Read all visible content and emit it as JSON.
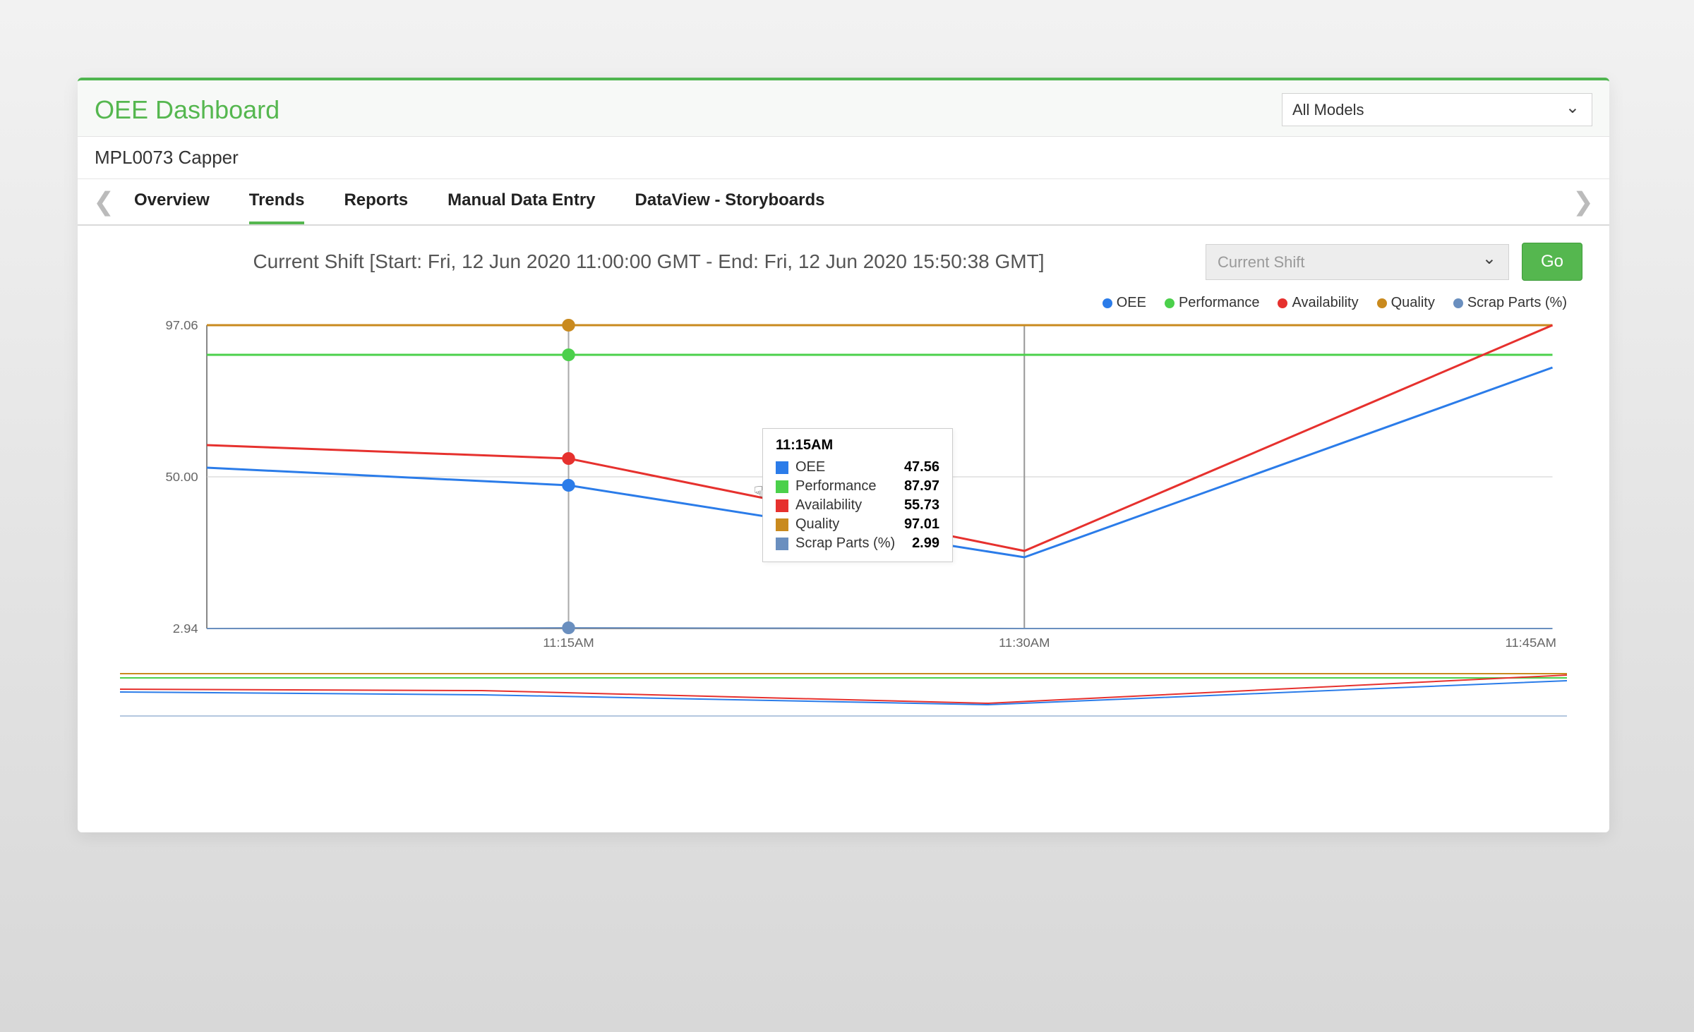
{
  "header": {
    "title": "OEE Dashboard",
    "model_placeholder": "All Models"
  },
  "equipment": "MPL0073 Capper",
  "tabs": {
    "overview": "Overview",
    "trends": "Trends",
    "reports": "Reports",
    "manual": "Manual Data Entry",
    "dataview": "DataView - Storyboards",
    "active": "trends"
  },
  "shift": {
    "label": "Current Shift [Start: Fri, 12 Jun 2020 11:00:00 GMT - End: Fri, 12 Jun 2020 15:50:38 GMT]",
    "select_placeholder": "Current Shift",
    "go_label": "Go"
  },
  "legend": {
    "oee": "OEE",
    "performance": "Performance",
    "availability": "Availability",
    "quality": "Quality",
    "scrap": "Scrap Parts (%)"
  },
  "tooltip": {
    "time": "11:15AM",
    "rows": {
      "oee_label": "OEE",
      "oee_val": "47.56",
      "perf_label": "Performance",
      "perf_val": "87.97",
      "avail_label": "Availability",
      "avail_val": "55.73",
      "qual_label": "Quality",
      "qual_val": "97.01",
      "scrap_label": "Scrap Parts (%)",
      "scrap_val": "2.99"
    }
  },
  "axis": {
    "y_top": "97.06",
    "y_mid": "50.00",
    "y_bot": "2.94",
    "x1": "11:15AM",
    "x2": "11:30AM",
    "x3": "11:45AM"
  },
  "colors": {
    "oee": "#2b7ce9",
    "performance": "#4bd04b",
    "availability": "#e6312e",
    "quality": "#c98a1e",
    "scrap": "#6a8fbf"
  },
  "chart_data": {
    "type": "line",
    "x": [
      "11:00AM",
      "11:15AM",
      "11:30AM",
      "11:45AM"
    ],
    "series": [
      {
        "name": "OEE",
        "color": "#2b7ce9",
        "values": [
          53,
          47.56,
          25,
          84
        ]
      },
      {
        "name": "Performance",
        "color": "#4bd04b",
        "values": [
          87.97,
          87.97,
          87.97,
          87.97
        ]
      },
      {
        "name": "Availability",
        "color": "#e6312e",
        "values": [
          60,
          55.73,
          27,
          97
        ]
      },
      {
        "name": "Quality",
        "color": "#c98a1e",
        "values": [
          97.06,
          97.01,
          97.06,
          97.06
        ]
      },
      {
        "name": "Scrap Parts (%)",
        "color": "#6a8fbf",
        "values": [
          2.94,
          2.99,
          2.94,
          2.94
        ]
      }
    ],
    "ylim": [
      2.94,
      97.06
    ],
    "xlabel": "",
    "ylabel": "",
    "title": ""
  }
}
